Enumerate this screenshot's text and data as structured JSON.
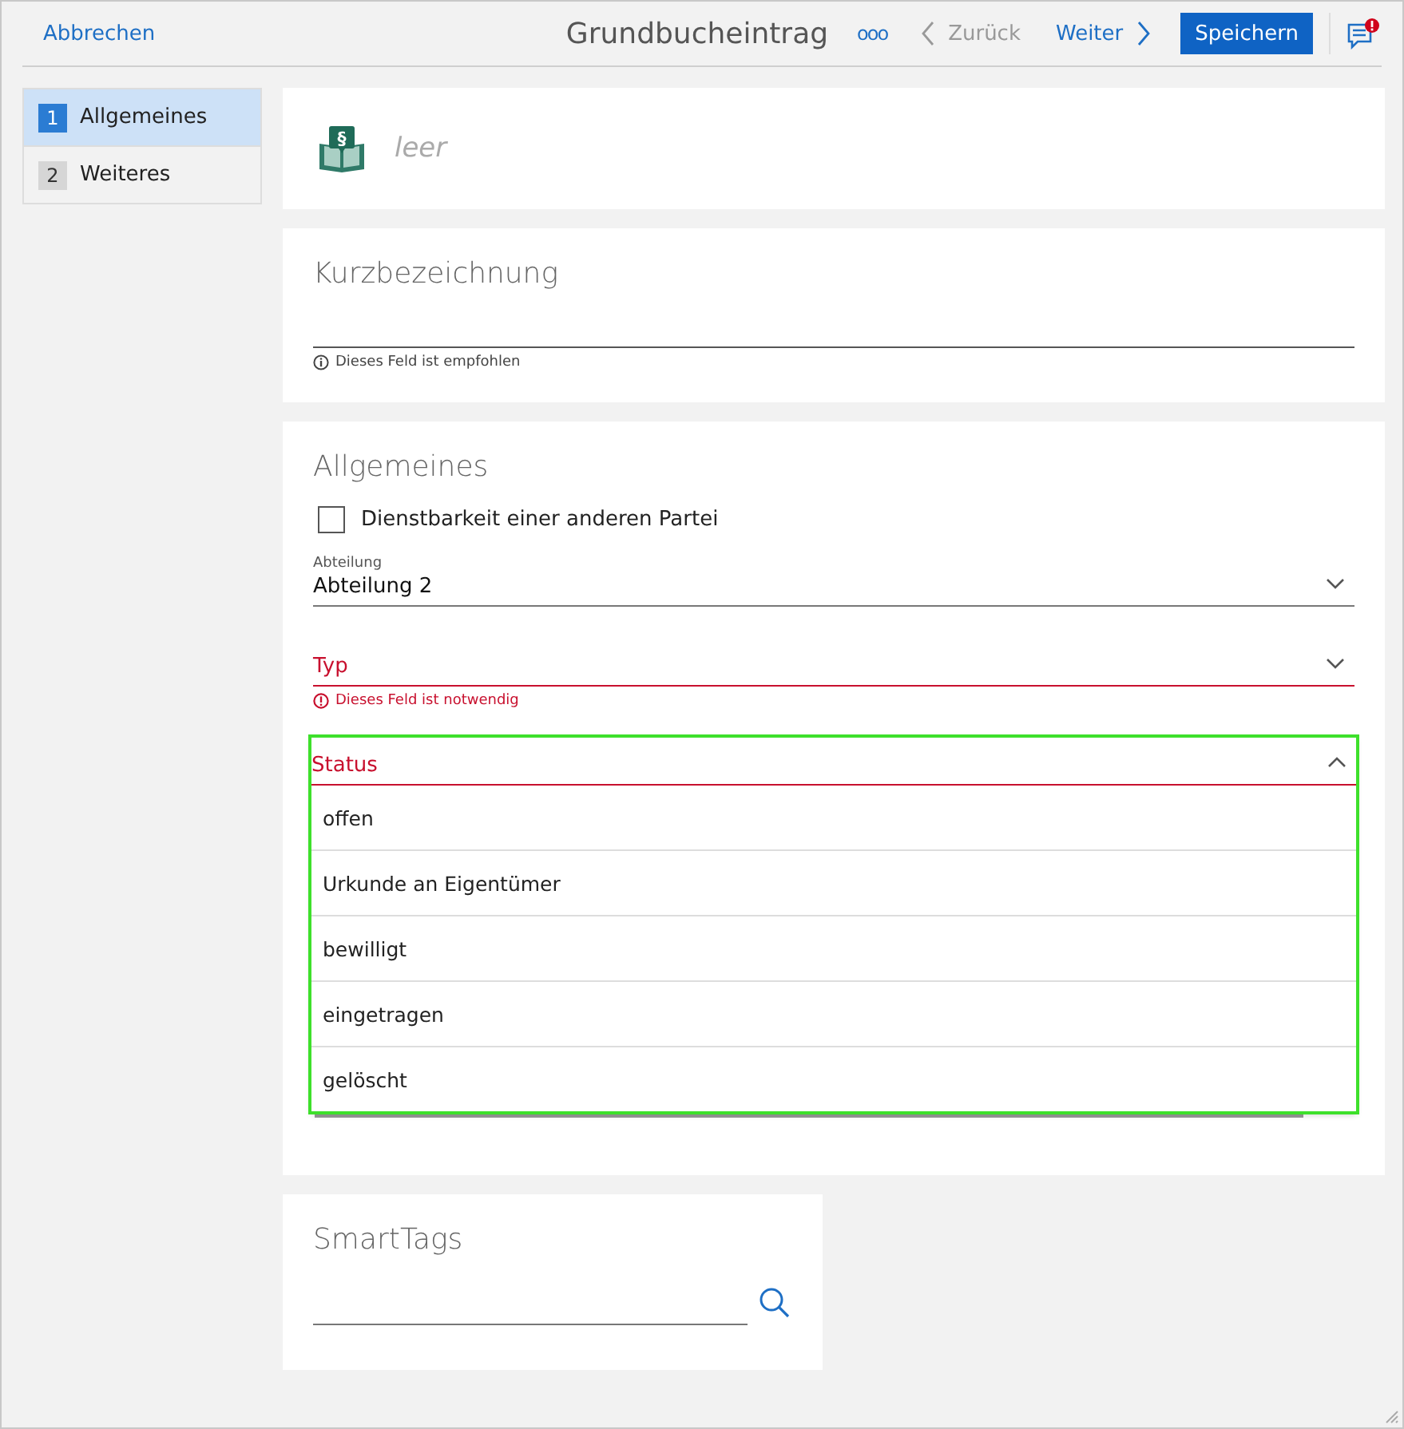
{
  "toolbar": {
    "cancel": "Abbrechen",
    "title": "Grundbucheintrag",
    "more": "ooo",
    "back": {
      "label": "Zurück",
      "disabled": true
    },
    "next": {
      "label": "Weiter",
      "disabled": false
    },
    "save": "Speichern",
    "notification": true
  },
  "sidebar": {
    "items": [
      {
        "number": "1",
        "label": "Allgemeines",
        "selected": true
      },
      {
        "number": "2",
        "label": "Weiteres",
        "selected": false
      }
    ]
  },
  "header": {
    "icon_mark": "§",
    "name": "leer"
  },
  "sections": [
    {
      "title": "Kurzbezeichnung",
      "fields": [
        {
          "kind": "text",
          "hint": {
            "kind": "info",
            "text": "Dieses Feld ist empfohlen"
          }
        }
      ]
    },
    {
      "title": "Allgemeines",
      "fields": [
        {
          "kind": "checkbox",
          "label": "Dienstbarkeit einer anderen Partei",
          "checked": false
        },
        {
          "kind": "select",
          "label": "Abteilung",
          "value": "Abteilung 2",
          "invalid": false,
          "expanded": false
        },
        {
          "kind": "select",
          "label": "Typ",
          "invalid": true,
          "expanded": false,
          "hint": {
            "kind": "error",
            "text": "Dieses Feld ist notwendig"
          }
        },
        {
          "kind": "select",
          "label": "Status",
          "invalid": true,
          "expanded": true,
          "options": [
            {
              "label": "offen",
              "selected": false
            },
            {
              "label": "Urkunde an Eigentümer",
              "selected": false
            },
            {
              "label": "bewilligt",
              "selected": false
            },
            {
              "label": "eingetragen",
              "selected": false
            },
            {
              "label": "gelöscht",
              "selected": false
            }
          ]
        }
      ]
    }
  ],
  "smarttags": {
    "title": "SmartTags"
  }
}
